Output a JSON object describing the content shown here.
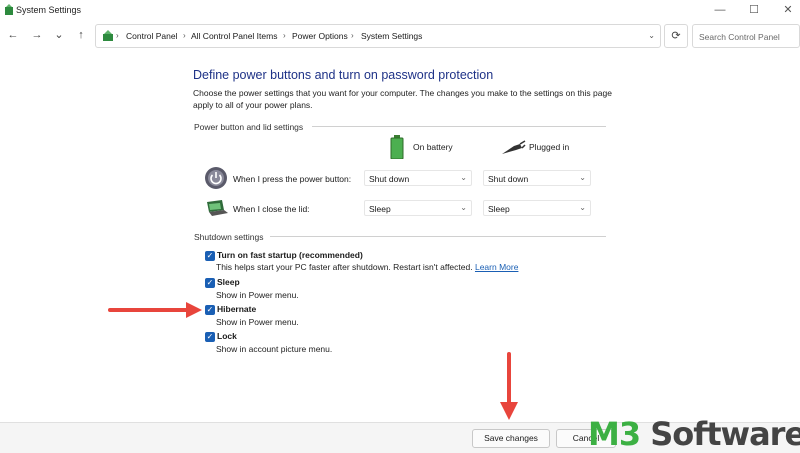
{
  "window": {
    "title": "System Settings",
    "controls": {
      "minimize": "—",
      "maximize": "☐",
      "close": "✕"
    }
  },
  "nav": {
    "back": "←",
    "forward": "→",
    "recent": "⌄",
    "up": "↑",
    "refresh": "⟳"
  },
  "address": {
    "breadcrumbs": [
      "Control Panel",
      "All Control Panel Items",
      "Power Options",
      "System Settings"
    ],
    "separator": "›",
    "dropdown": "⌄"
  },
  "search": {
    "placeholder": "Search Control Panel"
  },
  "main": {
    "title": "Define power buttons and turn on password protection",
    "description": "Choose the power settings that you want for your computer. The changes you make to the settings on this page apply to all of your power plans.",
    "power_section": {
      "label": "Power button and lid settings",
      "columns": {
        "battery": "On battery",
        "plugged": "Plugged in"
      },
      "rows": [
        {
          "label": "When I press the power button:",
          "battery": "Shut down",
          "plugged": "Shut down"
        },
        {
          "label": "When I close the lid:",
          "battery": "Sleep",
          "plugged": "Sleep"
        }
      ]
    },
    "shutdown_section": {
      "label": "Shutdown settings",
      "items": [
        {
          "title": "Turn on fast startup (recommended)",
          "desc": "This helps start your PC faster after shutdown. Restart isn't affected.",
          "link": "Learn More",
          "checked": true
        },
        {
          "title": "Sleep",
          "desc": "Show in Power menu.",
          "checked": true
        },
        {
          "title": "Hibernate",
          "desc": "Show in Power menu.",
          "checked": true
        },
        {
          "title": "Lock",
          "desc": "Show in account picture menu.",
          "checked": true
        }
      ]
    }
  },
  "footer": {
    "save": "Save changes",
    "cancel": "Cancel"
  },
  "watermark": {
    "m3": "M3",
    "software": " Software"
  },
  "colors": {
    "title": "#1e3287",
    "checkbox": "#1a5fb4",
    "arrow": "#e8453c",
    "watermark_green": "#3cb043"
  },
  "icons": [
    "app-icon",
    "back-icon",
    "forward-icon",
    "up-icon",
    "control-panel-icon",
    "refresh-icon",
    "battery-icon",
    "plug-icon",
    "power-button-icon",
    "laptop-lid-icon",
    "checkbox-check-icon"
  ],
  "checkmark": "✓",
  "chevron": "⌄"
}
